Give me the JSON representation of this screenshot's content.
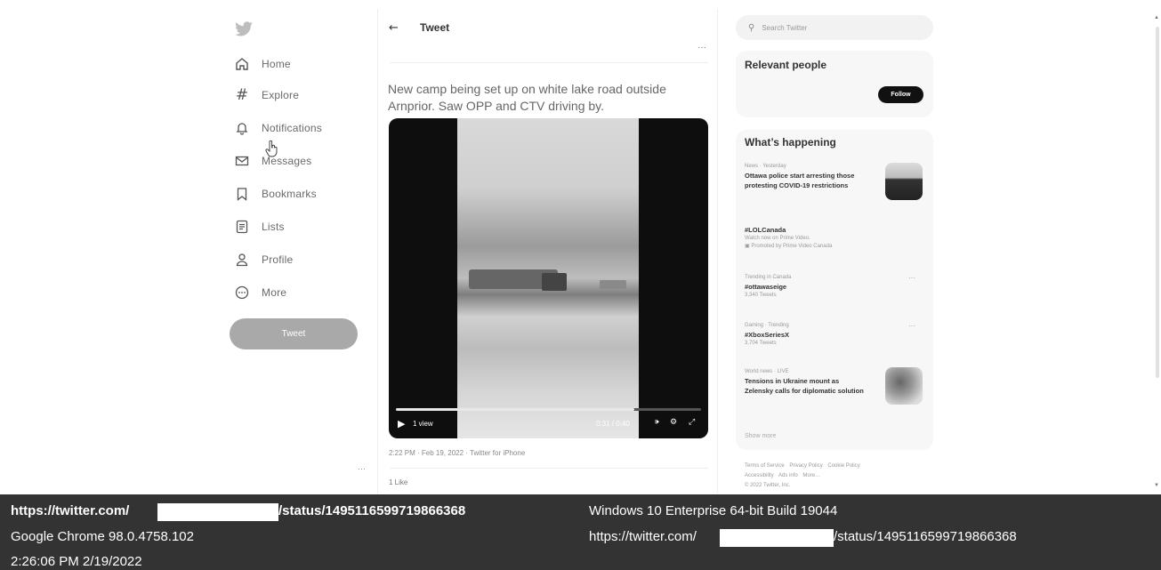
{
  "nav": {
    "logo": "bird-logo",
    "items": [
      {
        "label": "Home",
        "icon": "home-icon"
      },
      {
        "label": "Explore",
        "icon": "hashtag-icon"
      },
      {
        "label": "Notifications",
        "icon": "bell-icon"
      },
      {
        "label": "Messages",
        "icon": "envelope-icon"
      },
      {
        "label": "Bookmarks",
        "icon": "bookmark-icon"
      },
      {
        "label": "Lists",
        "icon": "list-icon"
      },
      {
        "label": "Profile",
        "icon": "person-icon"
      },
      {
        "label": "More",
        "icon": "more-circle-icon"
      }
    ],
    "tweet_button": "Tweet",
    "dots": "···"
  },
  "header": {
    "title": "Tweet",
    "back": "←"
  },
  "tweet": {
    "text": "New camp being set up on white lake road outside Arnprior. Saw OPP and CTV driving by.",
    "video": {
      "views": "1 view",
      "time": "0:31 / 0:40",
      "progress": 0.78
    },
    "meta": "2:22 PM · Feb 19, 2022 · Twitter for iPhone",
    "likes": "1 Like"
  },
  "search": {
    "placeholder": "Search Twitter"
  },
  "relevant": {
    "title": "Relevant people",
    "follow": "Follow"
  },
  "happening": {
    "title": "What’s happening",
    "trends": [
      {
        "meta": "News · Yesterday",
        "title": "Ottawa police start arresting those protesting COVID-19 restrictions",
        "sub": ""
      },
      {
        "meta": "",
        "title": "#LOLCanada",
        "sub": "Watch now on Prime Video.",
        "sub2": "Promoted by Prime Video Canada"
      },
      {
        "meta": "Trending in Canada",
        "title": "#ottawaseige",
        "sub": "3,340 Tweets"
      },
      {
        "meta": "Gaming · Trending",
        "title": "#XboxSeriesX",
        "sub": "3,704 Tweets"
      },
      {
        "meta": "World news · LIVE",
        "title": "Tensions in Ukraine mount as Zelensky calls for diplomatic solution",
        "sub": ""
      }
    ],
    "show_more": "Show more"
  },
  "footer": {
    "links": [
      "Terms of Service",
      "Privacy Policy",
      "Cookie Policy",
      "Accessibility",
      "Ads info",
      "More…"
    ],
    "copyright": "© 2022 Twitter, Inc."
  },
  "infobar": {
    "url_left_prefix": "https://twitter.com/",
    "url_left_suffix": "/status/1495116599719866368",
    "browser": "Google Chrome 98.0.4758.102",
    "datetime": "2:26:06 PM 2/19/2022",
    "os": "Windows 10 Enterprise 64-bit Build 19044",
    "url_right_prefix": "https://twitter.com/",
    "url_right_suffix": "/status/1495116599719866368"
  }
}
